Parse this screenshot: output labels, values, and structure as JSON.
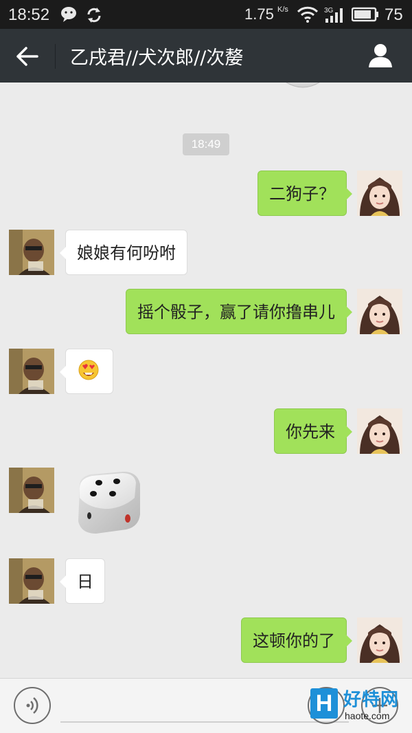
{
  "status_bar": {
    "time": "18:52",
    "network_speed": "1.75",
    "network_speed_unit": "K/s",
    "network_type": "3G",
    "battery_level": "75",
    "icons": [
      "wechat-icon",
      "sync-icon",
      "wifi-icon",
      "signal-icon",
      "battery-icon"
    ]
  },
  "header": {
    "title": "乙戌君//犬次郎//次嫠",
    "back_icon": "back-arrow-icon",
    "profile_icon": "person-icon"
  },
  "chat": {
    "timestamp": "18:49",
    "messages": [
      {
        "sender": "me",
        "type": "text",
        "text": "二狗子？"
      },
      {
        "sender": "them",
        "type": "text",
        "text": "娘娘有何吩咐"
      },
      {
        "sender": "me",
        "type": "text",
        "text": "摇个骰子，赢了请你撸串儿"
      },
      {
        "sender": "them",
        "type": "emoji",
        "text": "😍"
      },
      {
        "sender": "me",
        "type": "text",
        "text": "你先来"
      },
      {
        "sender": "them",
        "type": "dice",
        "value": 4
      },
      {
        "sender": "them",
        "type": "text",
        "text": "日"
      },
      {
        "sender": "me",
        "type": "text",
        "text": "这顿你的了"
      }
    ]
  },
  "input_bar": {
    "voice_icon": "voice-icon",
    "input_value": "",
    "emoji_icon": "emoji-icon",
    "plus_icon": "plus-icon"
  },
  "watermark": {
    "logo": "H",
    "name": "好特网",
    "url": "haote.com"
  },
  "colors": {
    "my_bubble": "#a1e15a",
    "their_bubble": "#ffffff",
    "titlebar": "#2f3438",
    "background": "#ebebeb",
    "watermark": "#1e90d8"
  }
}
